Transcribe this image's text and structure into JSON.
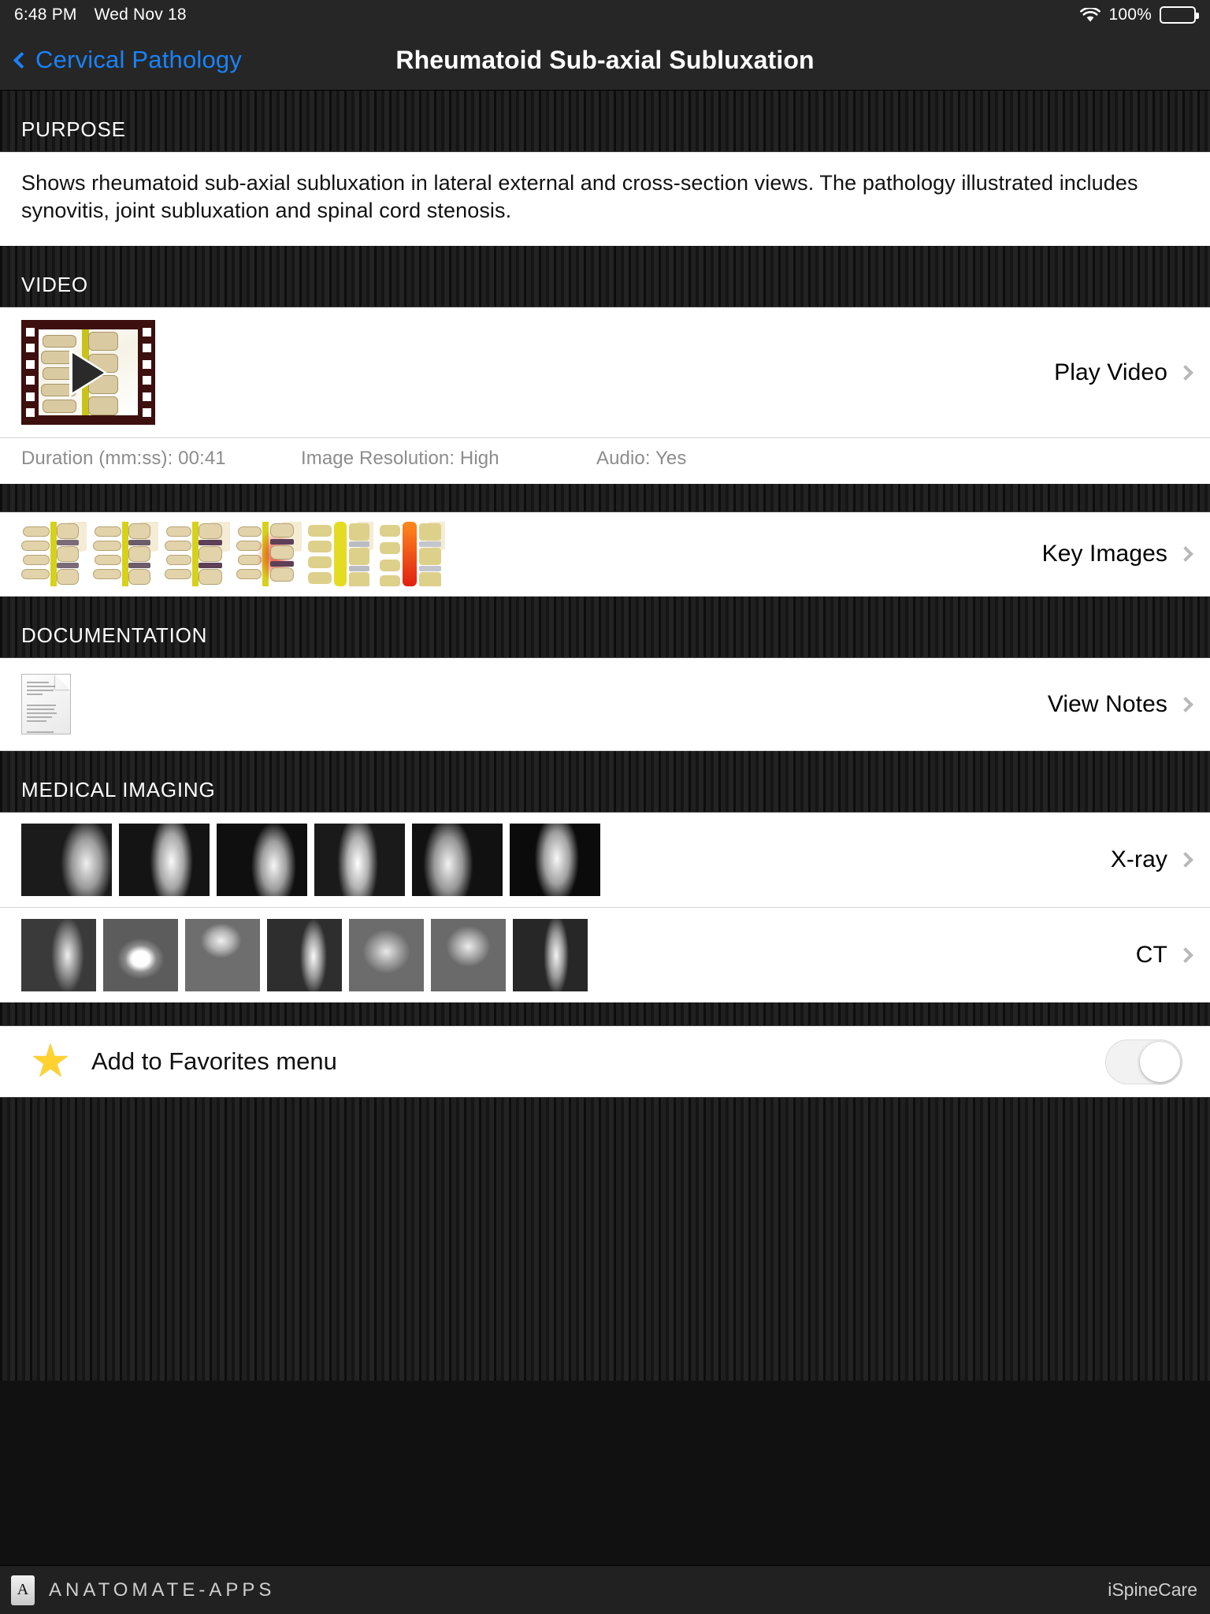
{
  "status_bar": {
    "time": "6:48 PM",
    "date": "Wed Nov 18",
    "battery_percent": "100%",
    "wifi_icon": "wifi-icon",
    "battery_icon": "battery-full-icon"
  },
  "nav": {
    "back_label": "Cervical Pathology",
    "back_icon": "chevron-left-icon",
    "title": "Rheumatoid Sub-axial Subluxation"
  },
  "sections": {
    "purpose": {
      "header": "PURPOSE",
      "body": "Shows rheumatoid sub-axial subluxation in lateral external and cross-section views. The pathology illustrated includes synovitis, joint subluxation and spinal cord stenosis."
    },
    "video": {
      "header": "VIDEO",
      "play_label": "Play Video",
      "thumb_icon": "film-strip-icon",
      "play_icon": "play-triangle-icon",
      "meta": {
        "duration": "Duration (mm:ss): 00:41",
        "resolution": "Image Resolution: High",
        "audio": "Audio: Yes"
      }
    },
    "key_images": {
      "label": "Key Images",
      "thumb_count": 6
    },
    "documentation": {
      "header": "DOCUMENTATION",
      "label": "View Notes",
      "icon": "document-page-icon"
    },
    "medical_imaging": {
      "header": "MEDICAL IMAGING",
      "rows": [
        {
          "label": "X-ray",
          "thumb_count": 6
        },
        {
          "label": "CT",
          "thumb_count": 7
        }
      ]
    },
    "favorites": {
      "label": "Add to Favorites menu",
      "icon": "star-icon",
      "toggle_state": "off"
    }
  },
  "footer": {
    "brand": "ANATOMATE-APPS",
    "logo_glyph": "A",
    "product": "iSpineCare"
  },
  "colors": {
    "accent_blue": "#1a82f7",
    "star_yellow": "#ffd230",
    "header_bg": "#262626",
    "stripe_bg": "#181818"
  }
}
